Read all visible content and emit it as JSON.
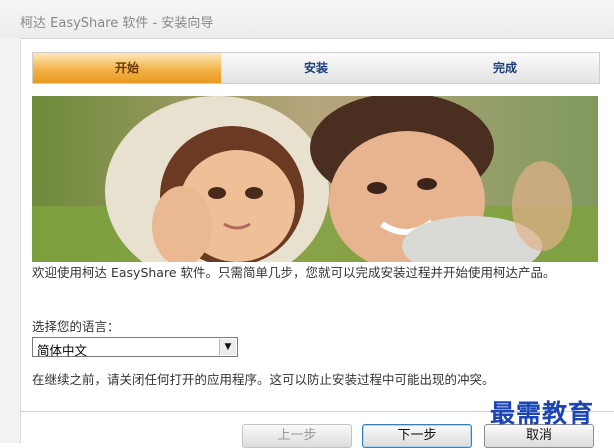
{
  "window": {
    "title": "柯达 EasyShare 软件 - 安装向导"
  },
  "steps": [
    {
      "label": "开始",
      "active": true
    },
    {
      "label": "安装",
      "active": false
    },
    {
      "label": "完成",
      "active": false
    }
  ],
  "content": {
    "welcome_text": "欢迎使用柯达 EasyShare 软件。只需简单几步，您就可以完成安装过程并开始使用柯达产品。",
    "language_label": "选择您的语言：",
    "language_selected": "简体中文",
    "note_text": "在继续之前，请关闭任何打开的应用程序。这可以防止安装过程中可能出现的冲突。"
  },
  "buttons": {
    "back": "上一步",
    "next": "下一步",
    "cancel": "取消"
  },
  "watermark": "最需教育",
  "colors": {
    "active_step": "#f3b24a",
    "step_text": "#1d3f7a",
    "watermark": "#1b44b5"
  }
}
